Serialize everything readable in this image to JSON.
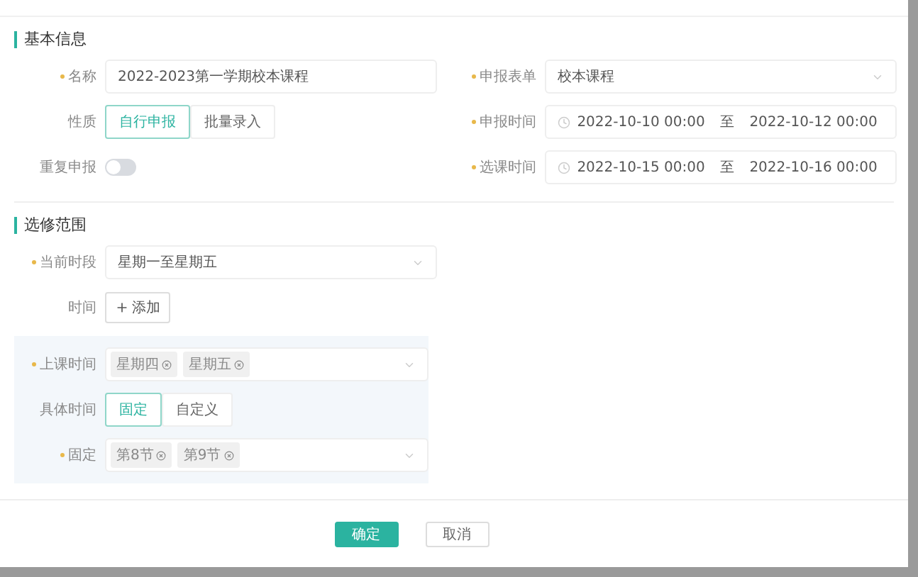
{
  "sections": [
    {
      "title": "基本信息",
      "kind": "grid",
      "left": [
        {
          "kind": "input",
          "label": "名称",
          "required": true,
          "value": "2022-2023第一学期校本课程"
        },
        {
          "kind": "segmented",
          "label": "性质",
          "required": false,
          "options": [
            {
              "label": "自行申报",
              "selected": true
            },
            {
              "label": "批量录入",
              "selected": false
            }
          ]
        },
        {
          "kind": "switch",
          "label": "重复申报",
          "required": false,
          "on": false
        }
      ],
      "right": [
        {
          "kind": "select",
          "label": "申报表单",
          "required": true,
          "value": "校本课程"
        },
        {
          "kind": "range",
          "label": "申报时间",
          "required": true,
          "start": "2022-10-10 00:00",
          "separator": "至",
          "end": "2022-10-12 00:00"
        },
        {
          "kind": "range",
          "label": "选课时间",
          "required": true,
          "start": "2022-10-15 00:00",
          "separator": "至",
          "end": "2022-10-16 00:00"
        }
      ]
    },
    {
      "title": "选修范围",
      "kind": "list",
      "left": [
        {
          "kind": "select",
          "label": "当前时段",
          "required": true,
          "value": "星期一至星期五"
        },
        {
          "kind": "add",
          "label": "时间",
          "required": false,
          "button": "添加"
        }
      ],
      "panel": [
        {
          "kind": "tags",
          "label": "上课时间",
          "required": true,
          "tags": [
            "星期四",
            "星期五"
          ]
        },
        {
          "kind": "segmented",
          "label": "具体时间",
          "required": false,
          "options": [
            {
              "label": "固定",
              "selected": true
            },
            {
              "label": "自定义",
              "selected": false
            }
          ]
        },
        {
          "kind": "tags",
          "label": "固定",
          "required": true,
          "tags": [
            "第8节",
            "第9节"
          ]
        }
      ]
    }
  ],
  "footer": {
    "buttons": [
      {
        "label": "确定",
        "kind": "primary"
      },
      {
        "label": "取消",
        "kind": "default"
      }
    ]
  }
}
